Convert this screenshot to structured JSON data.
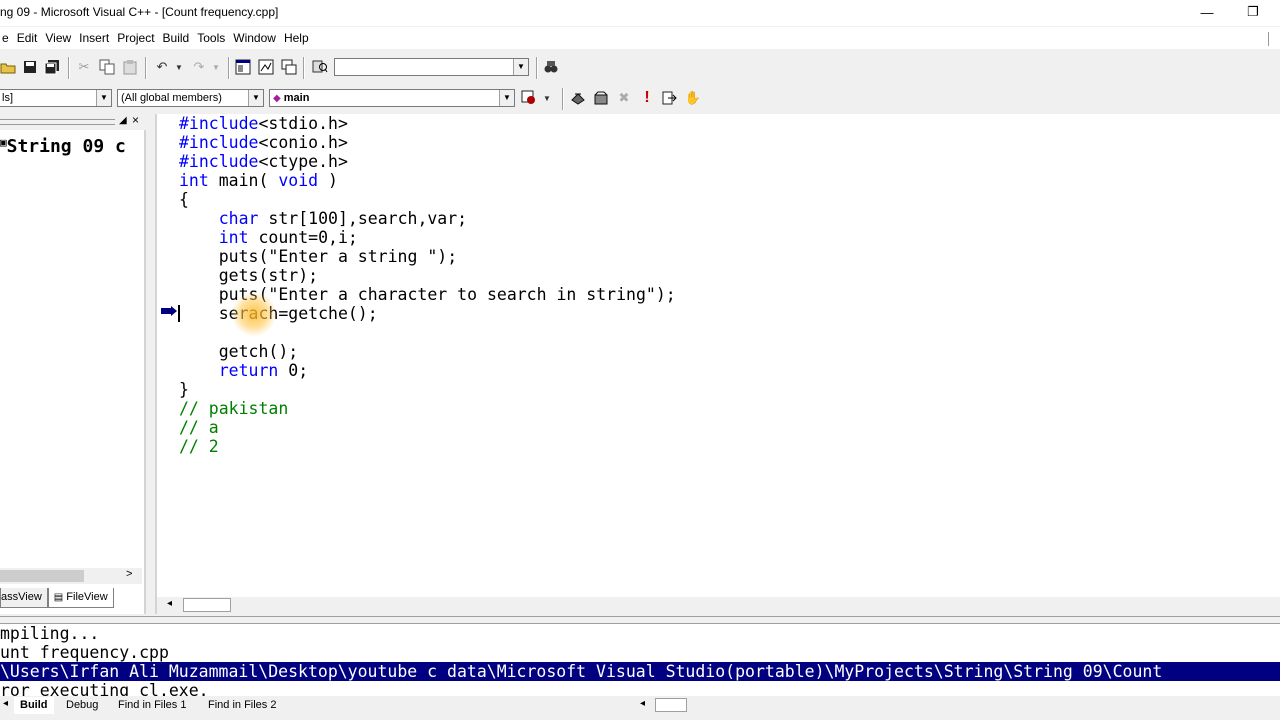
{
  "window": {
    "title": "ng 09 - Microsoft Visual C++ - [Count frequency.cpp]",
    "minimize_glyph": "—",
    "restore_glyph": "❐"
  },
  "menu": [
    "e",
    "Edit",
    "View",
    "Insert",
    "Project",
    "Build",
    "Tools",
    "Window",
    "Help"
  ],
  "toolbar2": {
    "class_combo": "ls]",
    "members_combo": "(All global members)",
    "function_combo": "main"
  },
  "workspace": {
    "tree_item": "String 09 c",
    "tabs": [
      "assView",
      "FileView"
    ]
  },
  "editor": {
    "lines": [
      {
        "parts": [
          {
            "t": "#include",
            "c": "kw"
          },
          {
            "t": "<stdio.h>",
            "c": ""
          }
        ]
      },
      {
        "parts": [
          {
            "t": "#include",
            "c": "kw"
          },
          {
            "t": "<conio.h>",
            "c": ""
          }
        ]
      },
      {
        "parts": [
          {
            "t": "#include",
            "c": "kw"
          },
          {
            "t": "<ctype.h>",
            "c": ""
          }
        ]
      },
      {
        "parts": [
          {
            "t": "int",
            "c": "kw"
          },
          {
            "t": " main( ",
            "c": ""
          },
          {
            "t": "void",
            "c": "kw"
          },
          {
            "t": " )",
            "c": ""
          }
        ]
      },
      {
        "parts": [
          {
            "t": "{",
            "c": ""
          }
        ]
      },
      {
        "parts": [
          {
            "t": "    ",
            "c": ""
          },
          {
            "t": "char",
            "c": "kw"
          },
          {
            "t": " str[100],search,var;",
            "c": ""
          }
        ]
      },
      {
        "parts": [
          {
            "t": "    ",
            "c": ""
          },
          {
            "t": "int",
            "c": "kw"
          },
          {
            "t": " count=0,i;",
            "c": ""
          }
        ]
      },
      {
        "parts": [
          {
            "t": "    puts(\"Enter a string \");",
            "c": ""
          }
        ]
      },
      {
        "parts": [
          {
            "t": "    gets(str);",
            "c": ""
          }
        ]
      },
      {
        "parts": [
          {
            "t": "    puts(\"Enter a character to search in string\");",
            "c": ""
          }
        ]
      },
      {
        "parts": [
          {
            "t": "    serach=getche();",
            "c": ""
          }
        ]
      },
      {
        "parts": [
          {
            "t": "",
            "c": ""
          }
        ]
      },
      {
        "parts": [
          {
            "t": "    getch();",
            "c": ""
          }
        ]
      },
      {
        "parts": [
          {
            "t": "    ",
            "c": ""
          },
          {
            "t": "return",
            "c": "kw"
          },
          {
            "t": " 0;",
            "c": ""
          }
        ]
      },
      {
        "parts": [
          {
            "t": "}",
            "c": ""
          }
        ]
      },
      {
        "parts": [
          {
            "t": "// pakistan",
            "c": "cm"
          }
        ]
      },
      {
        "parts": [
          {
            "t": "// a",
            "c": "cm"
          }
        ]
      },
      {
        "parts": [
          {
            "t": "// 2",
            "c": "cm"
          }
        ]
      }
    ]
  },
  "output": {
    "lines": [
      {
        "text": "mpiling...",
        "selected": false
      },
      {
        "text": "unt frequency.cpp",
        "selected": false
      },
      {
        "text": "\\Users\\Irfan Ali Muzammail\\Desktop\\youtube c data\\Microsoft Visual Studio(portable)\\MyProjects\\String\\String 09\\Count",
        "selected": true
      },
      {
        "text": "ror executing cl.exe.",
        "selected": false
      }
    ],
    "tabs": [
      "Build",
      "Debug",
      "Find in Files 1",
      "Find in Files 2"
    ]
  },
  "colors": {
    "keyword": "#0000ff",
    "comment": "#008000",
    "selection": "#000080",
    "exec_arrow": "#000080"
  }
}
